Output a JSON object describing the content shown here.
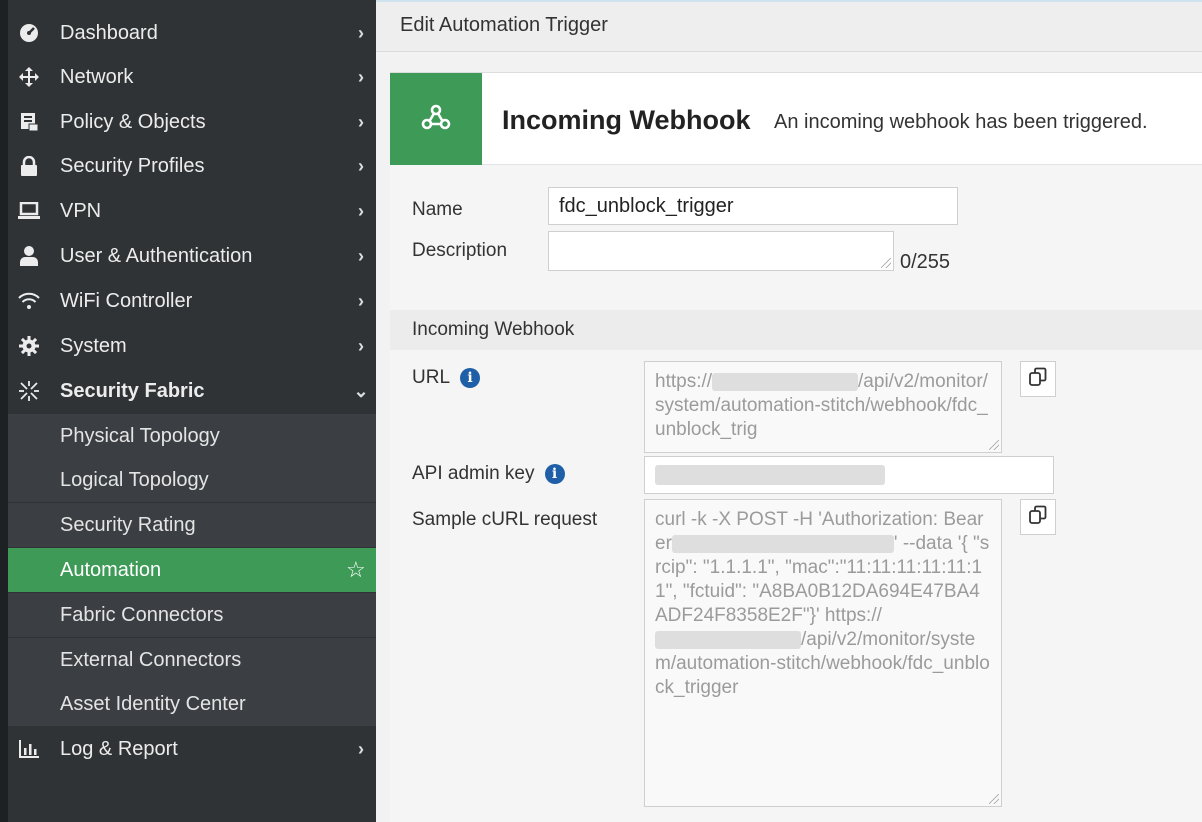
{
  "sidebar": {
    "items": [
      {
        "label": "Dashboard",
        "icon": "dashboard-icon"
      },
      {
        "label": "Network",
        "icon": "network-icon"
      },
      {
        "label": "Policy & Objects",
        "icon": "policy-icon"
      },
      {
        "label": "Security Profiles",
        "icon": "lock-icon"
      },
      {
        "label": "VPN",
        "icon": "laptop-icon"
      },
      {
        "label": "User & Authentication",
        "icon": "user-icon"
      },
      {
        "label": "WiFi Controller",
        "icon": "wifi-icon"
      },
      {
        "label": "System",
        "icon": "gear-icon"
      },
      {
        "label": "Security Fabric",
        "icon": "fabric-icon"
      },
      {
        "label": "Log & Report",
        "icon": "chart-icon"
      }
    ],
    "sub_items": [
      {
        "label": "Physical Topology"
      },
      {
        "label": "Logical Topology"
      },
      {
        "label": "Security Rating"
      },
      {
        "label": "Automation"
      },
      {
        "label": "Fabric Connectors"
      },
      {
        "label": "External Connectors"
      },
      {
        "label": "Asset Identity Center"
      }
    ]
  },
  "topbar": {
    "title": "Edit Automation Trigger"
  },
  "trigger": {
    "title": "Incoming Webhook",
    "description": "An incoming webhook has been triggered."
  },
  "form": {
    "name_label": "Name",
    "name_value": "fdc_unblock_trigger",
    "description_label": "Description",
    "description_count": "0/255",
    "section_title": "Incoming Webhook",
    "url_label": "URL",
    "url_prefix": "https://",
    "url_rest": "/api/v2/monitor/system/automation-stitch/webhook/fdc_unblock_trig",
    "api_key_label": "API admin key",
    "curl_label": "Sample cURL request",
    "curl_line1": "curl -k -X POST -H 'Authorization: Bearer",
    "curl_line2": "' --data '{ \"srcip\": \"1.1.1.1\", \"mac\":\"11:11:11:11:11:11\", \"fctuid\": \"A8BA0B12DA694E47BA4ADF24F8358E2F\"}'",
    "curl_url_prefix": "https://",
    "curl_url_rest": "/api/v2/monitor/system/automation-stitch/webhook/fdc_unblock_trigger"
  },
  "colors": {
    "accent_green": "#3e9a57",
    "sidebar_bg": "#2f3336",
    "info_blue": "#1f5fa8"
  }
}
